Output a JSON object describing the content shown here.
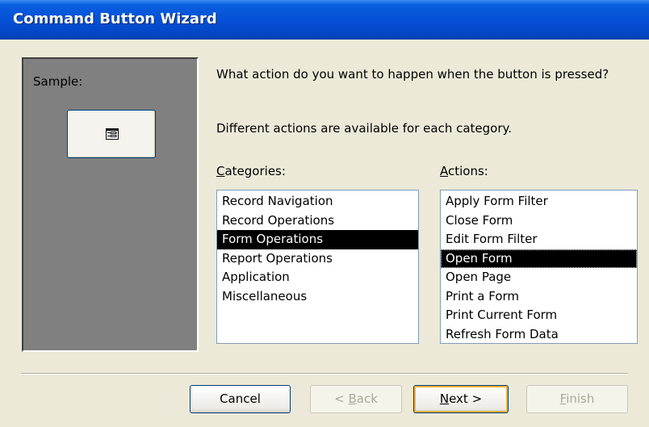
{
  "window": {
    "title": "Command Button Wizard"
  },
  "sample": {
    "label": "Sample:",
    "button_icon": "form-icon"
  },
  "prompt": "What action do you want to happen when the button is pressed?",
  "info": "Different actions are available for each category.",
  "categories": {
    "label_accel": "C",
    "label_rest": "ategories:",
    "items": [
      "Record Navigation",
      "Record Operations",
      "Form Operations",
      "Report Operations",
      "Application",
      "Miscellaneous"
    ],
    "selected": "Form Operations"
  },
  "actions": {
    "label_accel": "A",
    "label_rest": "ctions:",
    "items": [
      "Apply Form Filter",
      "Close Form",
      "Edit Form Filter",
      "Open Form",
      "Open Page",
      "Print a Form",
      "Print Current Form",
      "Refresh Form Data"
    ],
    "selected": "Open Form"
  },
  "buttons": {
    "cancel": "Cancel",
    "back_prefix": "< ",
    "back_accel": "B",
    "back_rest": "ack",
    "next_accel": "N",
    "next_rest": "ext >",
    "finish_accel": "F",
    "finish_rest": "inish"
  }
}
